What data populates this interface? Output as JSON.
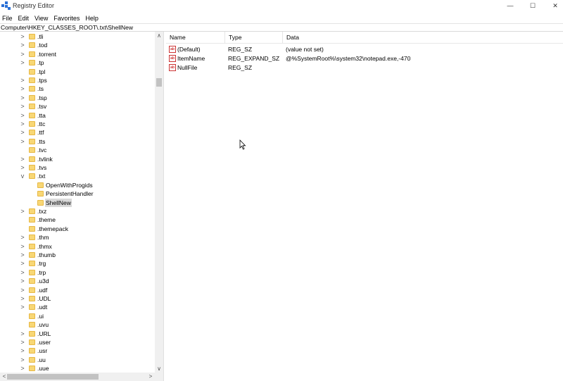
{
  "window": {
    "title": "Registry Editor",
    "icon": "registry-editor-icon"
  },
  "controls": {
    "minimize": "—",
    "maximize": "☐",
    "close": "✕"
  },
  "menu": [
    "File",
    "Edit",
    "View",
    "Favorites",
    "Help"
  ],
  "address": "Computer\\HKEY_CLASSES_ROOT\\.txt\\ShellNew",
  "tree": [
    {
      "label": ".tli",
      "expander": ">"
    },
    {
      "label": ".tod",
      "expander": ">"
    },
    {
      "label": ".torrent",
      "expander": ">"
    },
    {
      "label": ".tp",
      "expander": ">"
    },
    {
      "label": ".tpl",
      "expander": ""
    },
    {
      "label": ".tps",
      "expander": ">"
    },
    {
      "label": ".ts",
      "expander": ">"
    },
    {
      "label": ".tsp",
      "expander": ">"
    },
    {
      "label": ".tsv",
      "expander": ">"
    },
    {
      "label": ".tta",
      "expander": ">"
    },
    {
      "label": ".ttc",
      "expander": ">"
    },
    {
      "label": ".ttf",
      "expander": ">"
    },
    {
      "label": ".tts",
      "expander": ">"
    },
    {
      "label": ".tvc",
      "expander": ""
    },
    {
      "label": ".tvlink",
      "expander": ">"
    },
    {
      "label": ".tvs",
      "expander": ">"
    },
    {
      "label": ".txt",
      "expander": "v"
    },
    {
      "label": "OpenWithProgids",
      "expander": "",
      "child": true
    },
    {
      "label": "PersistentHandler",
      "expander": "",
      "child": true
    },
    {
      "label": "ShellNew",
      "expander": "",
      "child": true,
      "selected": true
    },
    {
      "label": ".txz",
      "expander": ">"
    },
    {
      "label": ".theme",
      "expander": ""
    },
    {
      "label": ".themepack",
      "expander": ""
    },
    {
      "label": ".thm",
      "expander": ">"
    },
    {
      "label": ".thmx",
      "expander": ">"
    },
    {
      "label": ".thumb",
      "expander": ">"
    },
    {
      "label": ".trg",
      "expander": ">"
    },
    {
      "label": ".trp",
      "expander": ">"
    },
    {
      "label": ".u3d",
      "expander": ">"
    },
    {
      "label": ".udf",
      "expander": ">"
    },
    {
      "label": ".UDL",
      "expander": ">"
    },
    {
      "label": ".udt",
      "expander": ">"
    },
    {
      "label": ".ui",
      "expander": ""
    },
    {
      "label": ".uvu",
      "expander": ""
    },
    {
      "label": ".URL",
      "expander": ">"
    },
    {
      "label": ".user",
      "expander": ">"
    },
    {
      "label": ".usr",
      "expander": ">"
    },
    {
      "label": ".uu",
      "expander": ">"
    },
    {
      "label": ".uue",
      "expander": ">"
    }
  ],
  "columns": [
    "Name",
    "Type",
    "Data"
  ],
  "values": [
    {
      "name": "(Default)",
      "type": "REG_SZ",
      "data": "(value not set)",
      "icon": "ab"
    },
    {
      "name": "ItemName",
      "type": "REG_EXPAND_SZ",
      "data": "@%SystemRoot%\\system32\\notepad.exe,-470",
      "icon": "ab"
    },
    {
      "name": "NullFile",
      "type": "REG_SZ",
      "data": "",
      "icon": "ab"
    }
  ],
  "colors": {
    "folder": "#f8d775",
    "selection": "#d9d9d9",
    "value_icon": "#cc3333"
  }
}
